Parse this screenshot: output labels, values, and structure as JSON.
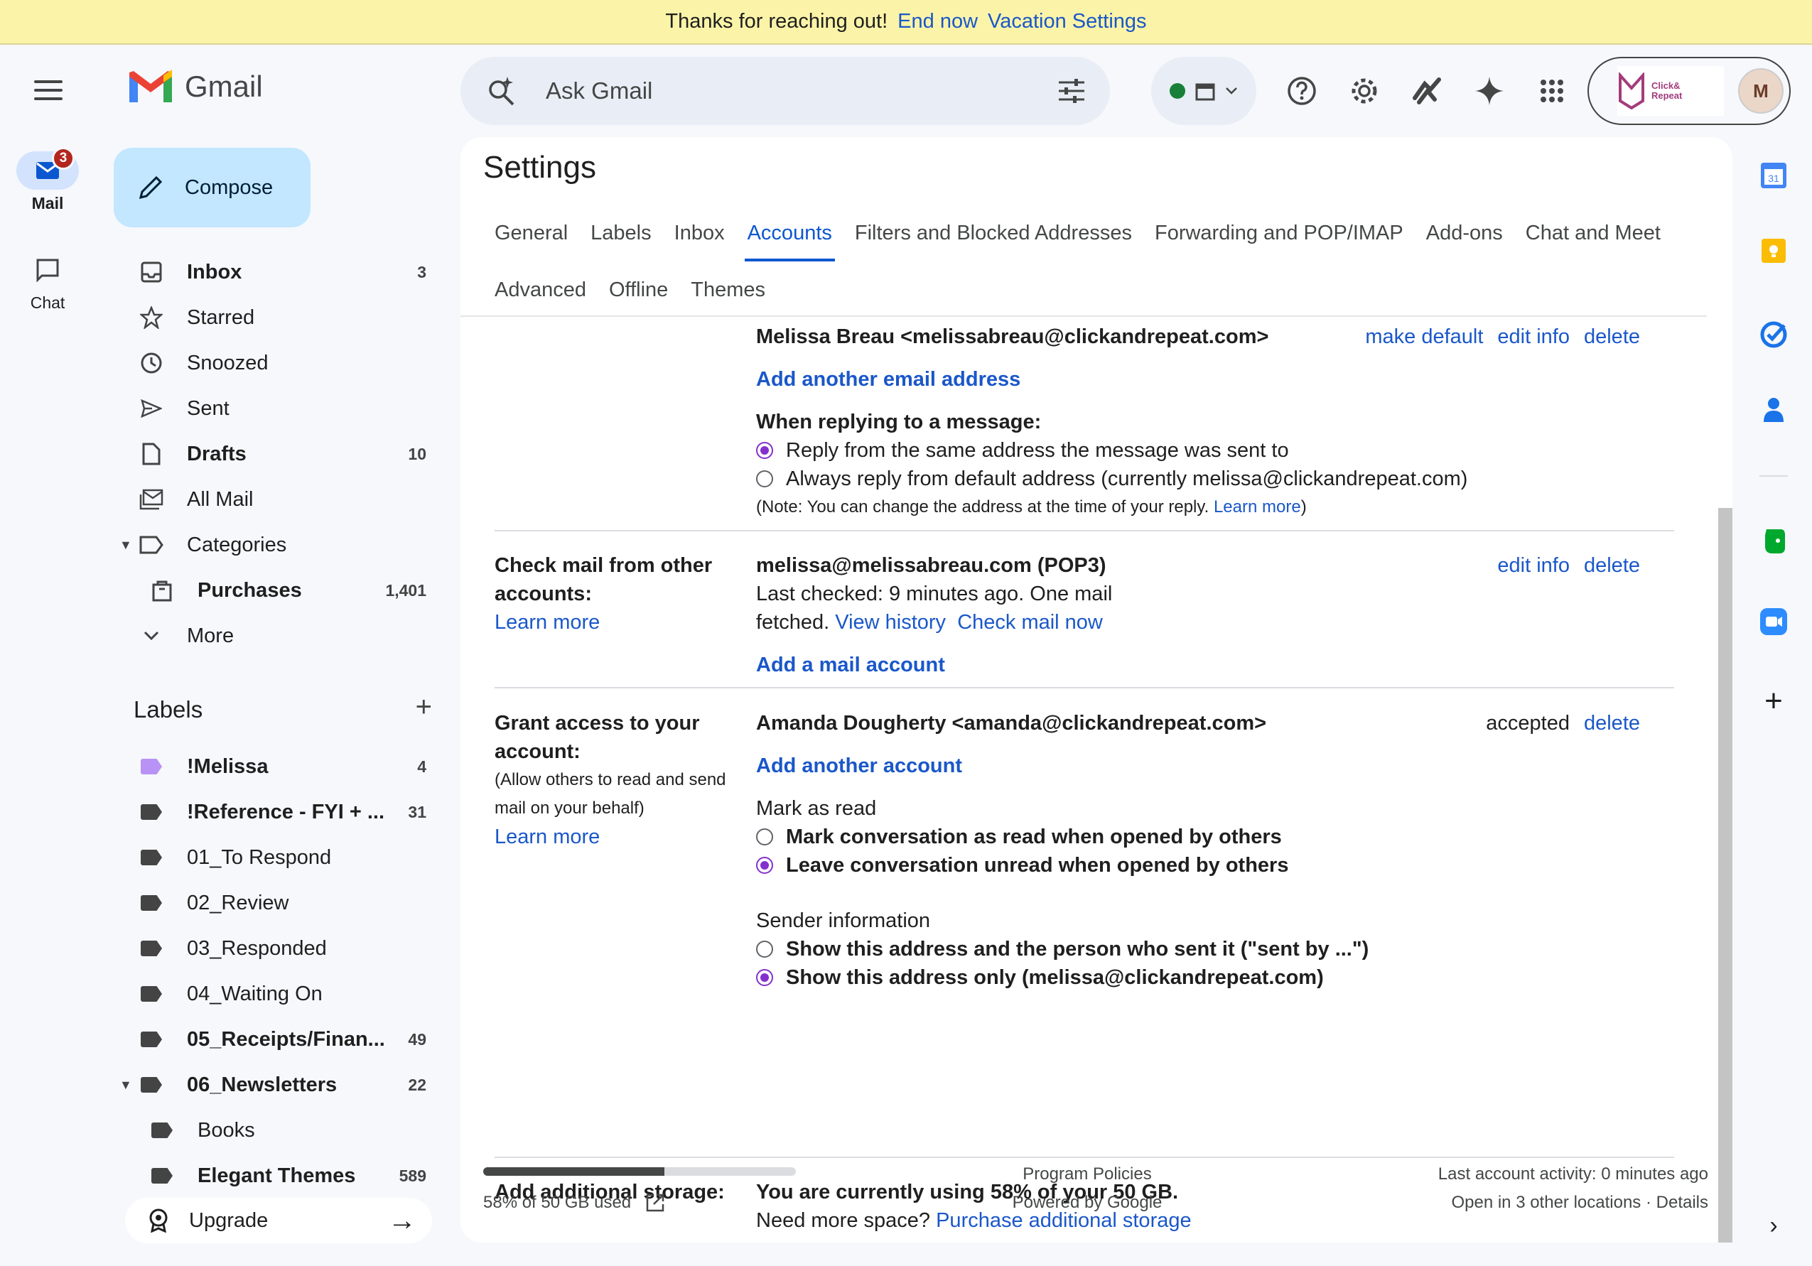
{
  "vacation": {
    "message": "Thanks for reaching out!",
    "end_now": "End now",
    "settings_link": "Vacation Settings"
  },
  "rail": {
    "mail_label": "Mail",
    "mail_badge": "3",
    "chat_label": "Chat"
  },
  "brand": {
    "name": "Gmail"
  },
  "compose": {
    "label": "Compose"
  },
  "nav": [
    {
      "label": "Inbox",
      "count": "3",
      "icon": "inbox-icon",
      "bold": true
    },
    {
      "label": "Starred",
      "count": "",
      "icon": "star-icon"
    },
    {
      "label": "Snoozed",
      "count": "",
      "icon": "clock-icon"
    },
    {
      "label": "Sent",
      "count": "",
      "icon": "send-icon"
    },
    {
      "label": "Drafts",
      "count": "10",
      "icon": "draft-icon",
      "bold": true
    },
    {
      "label": "All Mail",
      "count": "",
      "icon": "all-mail-icon"
    },
    {
      "label": "Categories",
      "count": "",
      "icon": "label-outline-icon"
    },
    {
      "label": "Purchases",
      "count": "1,401",
      "icon": "shopping-bag-icon",
      "bold": true
    },
    {
      "label": "More",
      "count": "",
      "icon": "chevron-down-icon"
    }
  ],
  "labels": {
    "heading": "Labels",
    "add_icon": "plus-icon",
    "items": [
      {
        "label": "!Melissa",
        "count": "4",
        "bold": true,
        "color": "#b892f5"
      },
      {
        "label": "!Reference - FYI + ...",
        "count": "31",
        "bold": true,
        "color": "#444444"
      },
      {
        "label": "01_To Respond",
        "count": "",
        "color": "#444444"
      },
      {
        "label": "02_Review",
        "count": "",
        "color": "#444444"
      },
      {
        "label": "03_Responded",
        "count": "",
        "color": "#444444"
      },
      {
        "label": "04_Waiting On",
        "count": "",
        "color": "#444444"
      },
      {
        "label": "05_Receipts/Finan...",
        "count": "49",
        "bold": true,
        "color": "#444444"
      },
      {
        "label": "06_Newsletters",
        "count": "22",
        "bold": true,
        "color": "#444444"
      },
      {
        "label": "Books",
        "count": "",
        "color": "#444444"
      },
      {
        "label": "Elegant Themes",
        "count": "589",
        "bold": true,
        "color": "#444444"
      }
    ],
    "upgrade": "Upgrade"
  },
  "search": {
    "placeholder": "Ask Gmail"
  },
  "account": {
    "logo_text_1": "Click&",
    "logo_text_2": "Repeat",
    "avatar_initial": "M"
  },
  "settings": {
    "title": "Settings",
    "tabs_row1": [
      "General",
      "Labels",
      "Inbox",
      "Accounts",
      "Filters and Blocked Addresses",
      "Forwarding and POP/IMAP",
      "Add-ons",
      "Chat and Meet"
    ],
    "tabs_row2": [
      "Advanced",
      "Offline",
      "Themes"
    ],
    "active_tab": "Accounts",
    "send_as": {
      "address": "Melissa Breau <melissabreau@clickandrepeat.com>",
      "make_default": "make default",
      "edit_info": "edit info",
      "delete": "delete",
      "add_another": "Add another email address",
      "reply_heading": "When replying to a message:",
      "reply_opt1": "Reply from the same address the message was sent to",
      "reply_opt2": "Always reply from default address (currently melissa@clickandrepeat.com)",
      "note_prefix": "(Note: You can change the address at the time of your reply.",
      "note_link": "Learn more",
      "note_suffix": ")"
    },
    "check_mail": {
      "label": "Check mail from other accounts:",
      "learn_more": "Learn more",
      "account": "melissa@melissabreau.com (POP3)",
      "last_checked_1": "Last checked: 9 minutes ago. One mail",
      "last_checked_2": "fetched.",
      "view_history": "View history",
      "check_now": "Check mail now",
      "edit_info": "edit info",
      "delete": "delete",
      "add_account": "Add a mail account"
    },
    "grant": {
      "label": "Grant access to your account:",
      "note": "(Allow others to read and send mail on your behalf)",
      "learn_more": "Learn more",
      "delegate": "Amanda Dougherty <amanda@clickandrepeat.com>",
      "status": "accepted",
      "delete": "delete",
      "add_another": "Add another account",
      "mark_heading": "Mark as read",
      "mark_opt1": "Mark conversation as read when opened by others",
      "mark_opt2": "Leave conversation unread when opened by others",
      "sender_heading": "Sender information",
      "sender_opt1": "Show this address and the person who sent it (\"sent by ...\")",
      "sender_opt2": "Show this address only (melissa@clickandrepeat.com)"
    },
    "storage": {
      "label": "Add additional storage:",
      "usage": "You are currently using 58% of your 50 GB.",
      "need_more": "Need more space?",
      "purchase": "Purchase additional storage"
    }
  },
  "footer": {
    "storage_text": "58% of 50 GB used",
    "storage_fraction": 0.58,
    "policies": "Program Policies",
    "powered": "Powered by Google",
    "last_activity": "Last account activity: 0 minutes ago",
    "other_locations": "Open in 3 other locations · Details"
  }
}
